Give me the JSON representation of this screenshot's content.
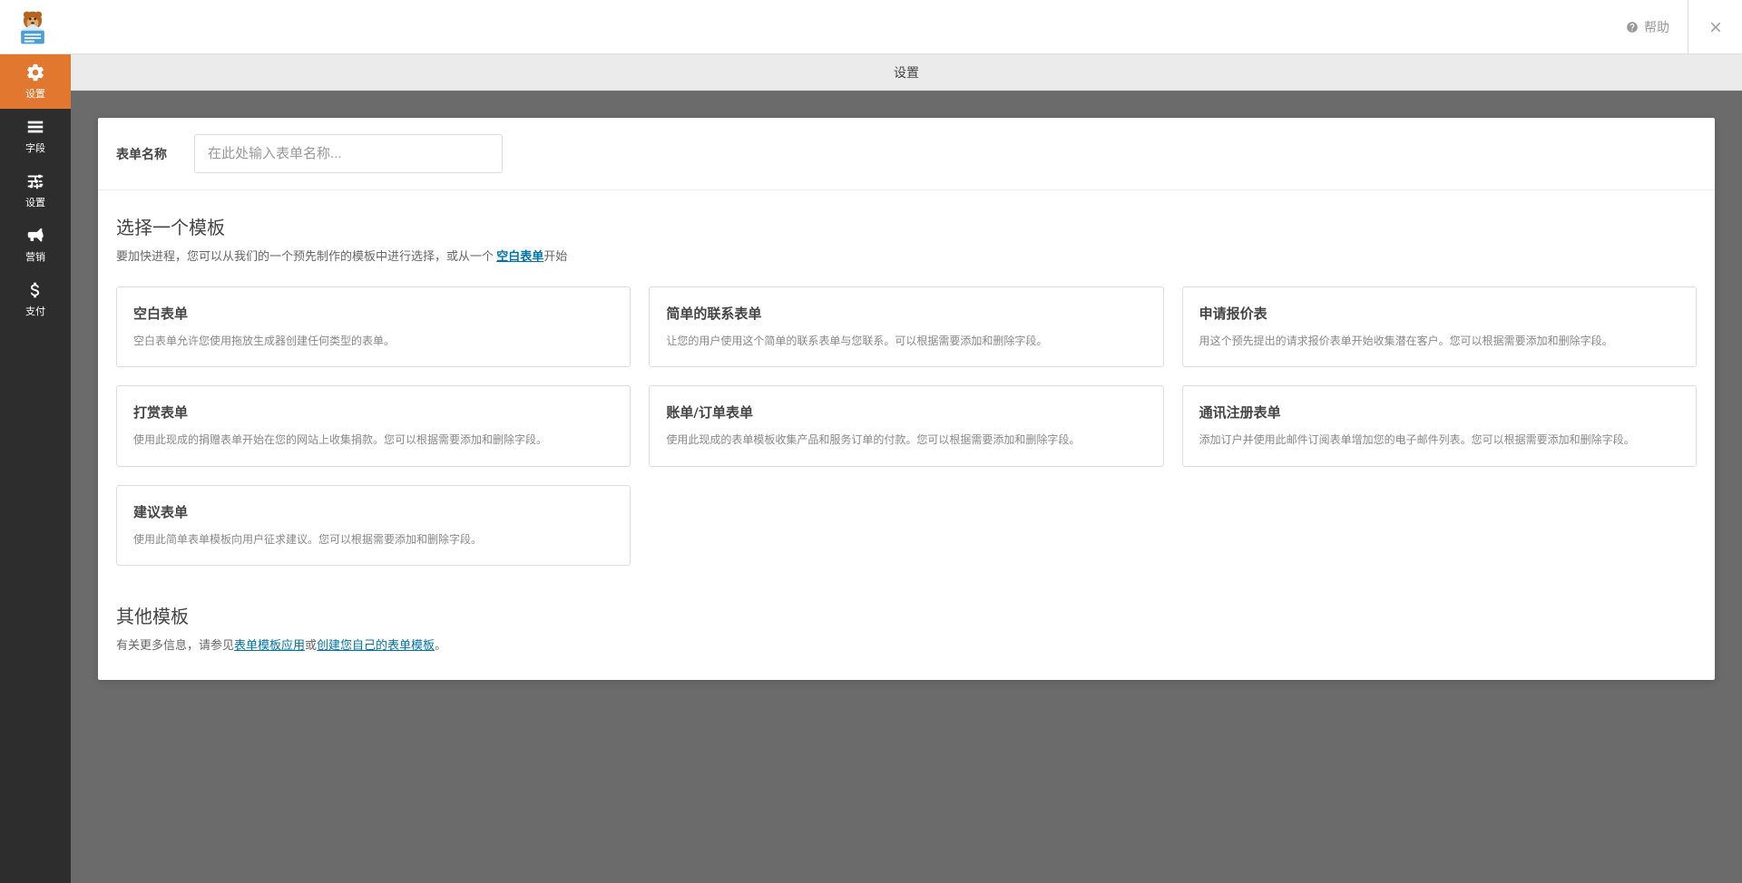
{
  "topbar": {
    "help_label": "帮助"
  },
  "sidebar": {
    "items": [
      {
        "label": "设置"
      },
      {
        "label": "字段"
      },
      {
        "label": "设置"
      },
      {
        "label": "营销"
      },
      {
        "label": "支付"
      }
    ]
  },
  "content_header": "设置",
  "form_name": {
    "label": "表单名称",
    "placeholder": "在此处输入表单名称..."
  },
  "select_template": {
    "title": "选择一个模板",
    "subtitle_prefix": "要加快进程，您可以从我们的一个预先制作的模板中进行选择，或从一个 ",
    "subtitle_link": "空白表单",
    "subtitle_suffix": "开始"
  },
  "templates": [
    {
      "title": "空白表单",
      "desc": "空白表单允许您使用拖放生成器创建任何类型的表单。"
    },
    {
      "title": "简单的联系表单",
      "desc": "让您的用户使用这个简单的联系表单与您联系。可以根据需要添加和删除字段。"
    },
    {
      "title": "申请报价表",
      "desc": "用这个预先提出的请求报价表单开始收集潜在客户。您可以根据需要添加和删除字段。"
    },
    {
      "title": "打赏表单",
      "desc": "使用此现成的捐赠表单开始在您的网站上收集捐款。您可以根据需要添加和删除字段。"
    },
    {
      "title": "账单/订单表单",
      "desc": "使用此现成的表单模板收集产品和服务订单的付款。您可以根据需要添加和删除字段。"
    },
    {
      "title": "通讯注册表单",
      "desc": "添加订户并使用此邮件订阅表单增加您的电子邮件列表。您可以根据需要添加和删除字段。"
    },
    {
      "title": "建议表单",
      "desc": "使用此简单表单模板向用户征求建议。您可以根据需要添加和删除字段。"
    }
  ],
  "extra": {
    "title": "其他模板",
    "prefix": "有关更多信息，请参见",
    "link1": "表单模板应用",
    "mid": "或",
    "link2": "创建您自己的表单模板",
    "suffix": "。"
  }
}
